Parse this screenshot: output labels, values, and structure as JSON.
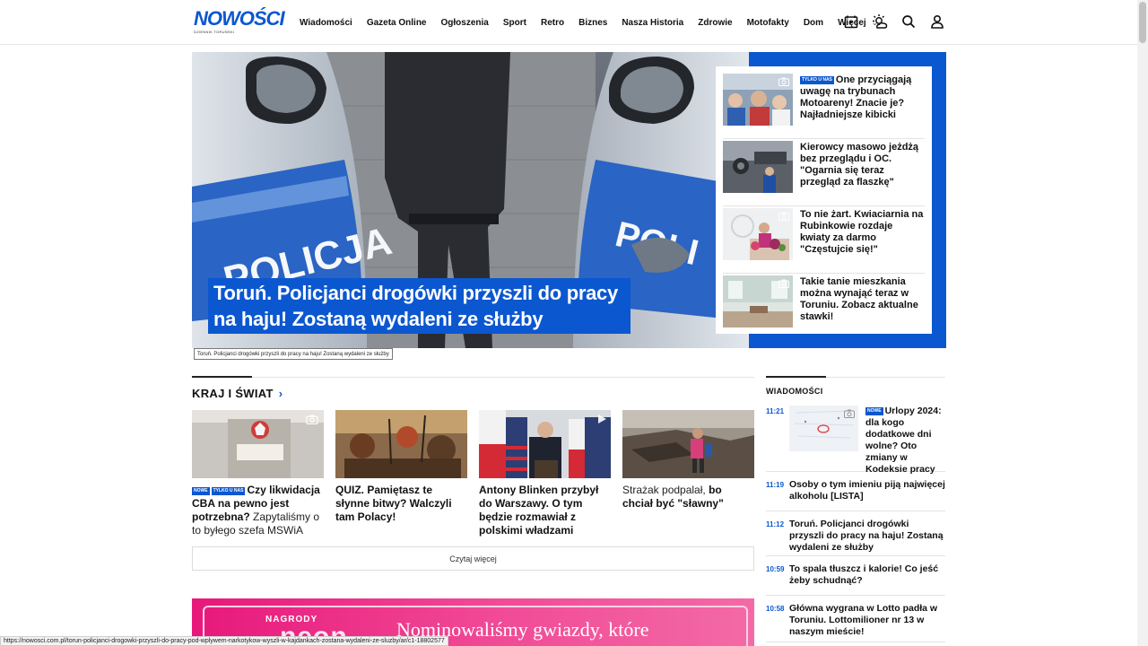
{
  "brand": {
    "name": "NOWOŚCI",
    "tagline": "DZIENNIK TORUŃSKI"
  },
  "nav": {
    "items": [
      "Wiadomości",
      "Gazeta Online",
      "Ogłoszenia",
      "Sport",
      "Retro",
      "Biznes",
      "Nasza Historia",
      "Zdrowie",
      "Motofakty",
      "Dom"
    ],
    "more_label": "Więcej"
  },
  "header_icons": [
    "video-play-icon",
    "weather-icon",
    "search-icon",
    "user-icon"
  ],
  "hero": {
    "title": "Toruń. Policjanci drogówki przyszli do pracy na haju! Zostaną wydaleni ze służby",
    "tooltip": "Toruń. Policjanci drogówki przyszli do pracy na haju! Zostaną wydaleni ze służby",
    "side_items": [
      {
        "badge": "TYLKO U NAS",
        "title": "One przyciągają uwagę na trybunach Motoareny! Znacie je? Najładniejsze kibicki",
        "has_gallery": true
      },
      {
        "badge": "",
        "title": "Kierowcy masowo jeżdżą bez przeglądu i OC. \"Ogarnia się teraz przegląd za flaszkę\"",
        "has_gallery": false
      },
      {
        "badge": "",
        "title": "To nie żart. Kwiaciarnia na Rubinkowie rozdaje kwiaty za darmo \"Częstujcie się!\"",
        "has_gallery": true
      },
      {
        "badge": "",
        "title": "Takie tanie mieszkania można wynająć teraz w Toruniu. Zobacz aktualne stawki!",
        "has_gallery": true
      }
    ]
  },
  "section": {
    "title": "KRAJ I ŚWIAT",
    "cards": [
      {
        "badges": [
          "NOWE",
          "TYLKO U NAS"
        ],
        "bold": "Czy likwidacja CBA na pewno jest potrzebna?",
        "light": " Zapytaliśmy o to byłego szefa MSWiA",
        "media": "gallery"
      },
      {
        "badges": [],
        "bold": "QUIZ. Pamiętasz te słynne bitwy? Walczyli tam Polacy!",
        "light": "",
        "media": ""
      },
      {
        "badges": [],
        "bold": "Antony Blinken przybył do Warszawy. O tym będzie rozmawiał z polskimi władzami",
        "light": "",
        "media": "video"
      },
      {
        "badges": [],
        "bold_prefix_light": "Strażak podpalał,",
        "bold": " bo chciał być \"sławny\"",
        "light": "",
        "media": ""
      }
    ],
    "more_label": "Czytaj więcej"
  },
  "ad": {
    "small": "NAGRODY",
    "big": "neon",
    "claim": "Nominowaliśmy gwiazdy, które"
  },
  "sidebar": {
    "title": "WIADOMOŚCI",
    "items": [
      {
        "time": "11:21",
        "badge": "NOWE",
        "title": "Urlopy 2024: dla kogo dodatkowe dni wolne? Oto zmiany w Kodeksie pracy"
      },
      {
        "time": "11:19",
        "badge": "",
        "title": "Osoby o tym imieniu piją najwięcej alkoholu [LISTA]"
      },
      {
        "time": "11:12",
        "badge": "",
        "title": "Toruń. Policjanci drogówki przyszli do pracy na haju! Zostaną wydaleni ze służby"
      },
      {
        "time": "10:59",
        "badge": "",
        "title": "To spala tłuszcz i kalorie! Co jeść żeby schudnąć?"
      },
      {
        "time": "10:58",
        "badge": "",
        "title": "Główna wygrana w Lotto padła w Toruniu. Lottomilioner nr 13 w naszym mieście!"
      }
    ]
  },
  "status_url": "https://nowosci.com.pl/torun-policjanci-drogowki-przyszli-do-pracy-pod-wplywem-narkotykow-wyszli-w-kajdankach-zostana-wydaleni-ze-sluzby/ar/c1-18802577",
  "colors": {
    "accent": "#0b57d0",
    "ad_pink": "#e7187b"
  }
}
